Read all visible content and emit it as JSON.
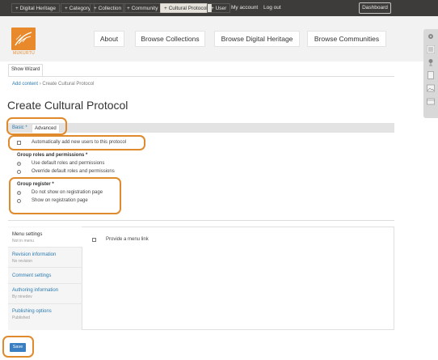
{
  "admin_bar": {
    "links": [
      "+ Digital Heritage",
      "+ Category",
      "+ Collection",
      "+ Community",
      "+ Cultural Protocol",
      "+ User"
    ],
    "my_account": "My account",
    "logout": "Log out",
    "dashboard": "Dashboard"
  },
  "header": {
    "logo_text": "MUKURTU",
    "nav": [
      "About",
      "Browse Collections",
      "Browse Digital Heritage",
      "Browse Communities"
    ]
  },
  "wizard": {
    "label": "Show Wizard"
  },
  "breadcrumb": {
    "link": "Add content",
    "separator": "›",
    "current": "Create Cultural Protocol"
  },
  "page_title": "Create Cultural Protocol",
  "tabs": {
    "basic": "Basic *",
    "advanced": "Advanced"
  },
  "form": {
    "auto_add_users": "Automatically add new users to this protocol",
    "group_roles_label": "Group roles and permissions *",
    "group_roles_options": [
      "Use default roles and permissions",
      "Override default roles and permissions"
    ],
    "group_register_label": "Group register *",
    "group_register_options": [
      "Do not show on registration page",
      "Show on registration page"
    ]
  },
  "vertical_tabs": {
    "items": [
      {
        "label": "Menu settings",
        "summary": "Not in menu"
      },
      {
        "label": "Revision information",
        "summary": "No revision"
      },
      {
        "label": "Comment settings",
        "summary": ""
      },
      {
        "label": "Authoring information",
        "summary": "By ninedev"
      },
      {
        "label": "Publishing options",
        "summary": "Published"
      }
    ],
    "menu_link_checkbox": "Provide a menu link"
  },
  "save_button": "Save",
  "colors": {
    "highlight": "#e08a2e",
    "link": "#2a7ab0",
    "admin_bar": "#3d3c3a",
    "save": "#3a7fc1"
  }
}
